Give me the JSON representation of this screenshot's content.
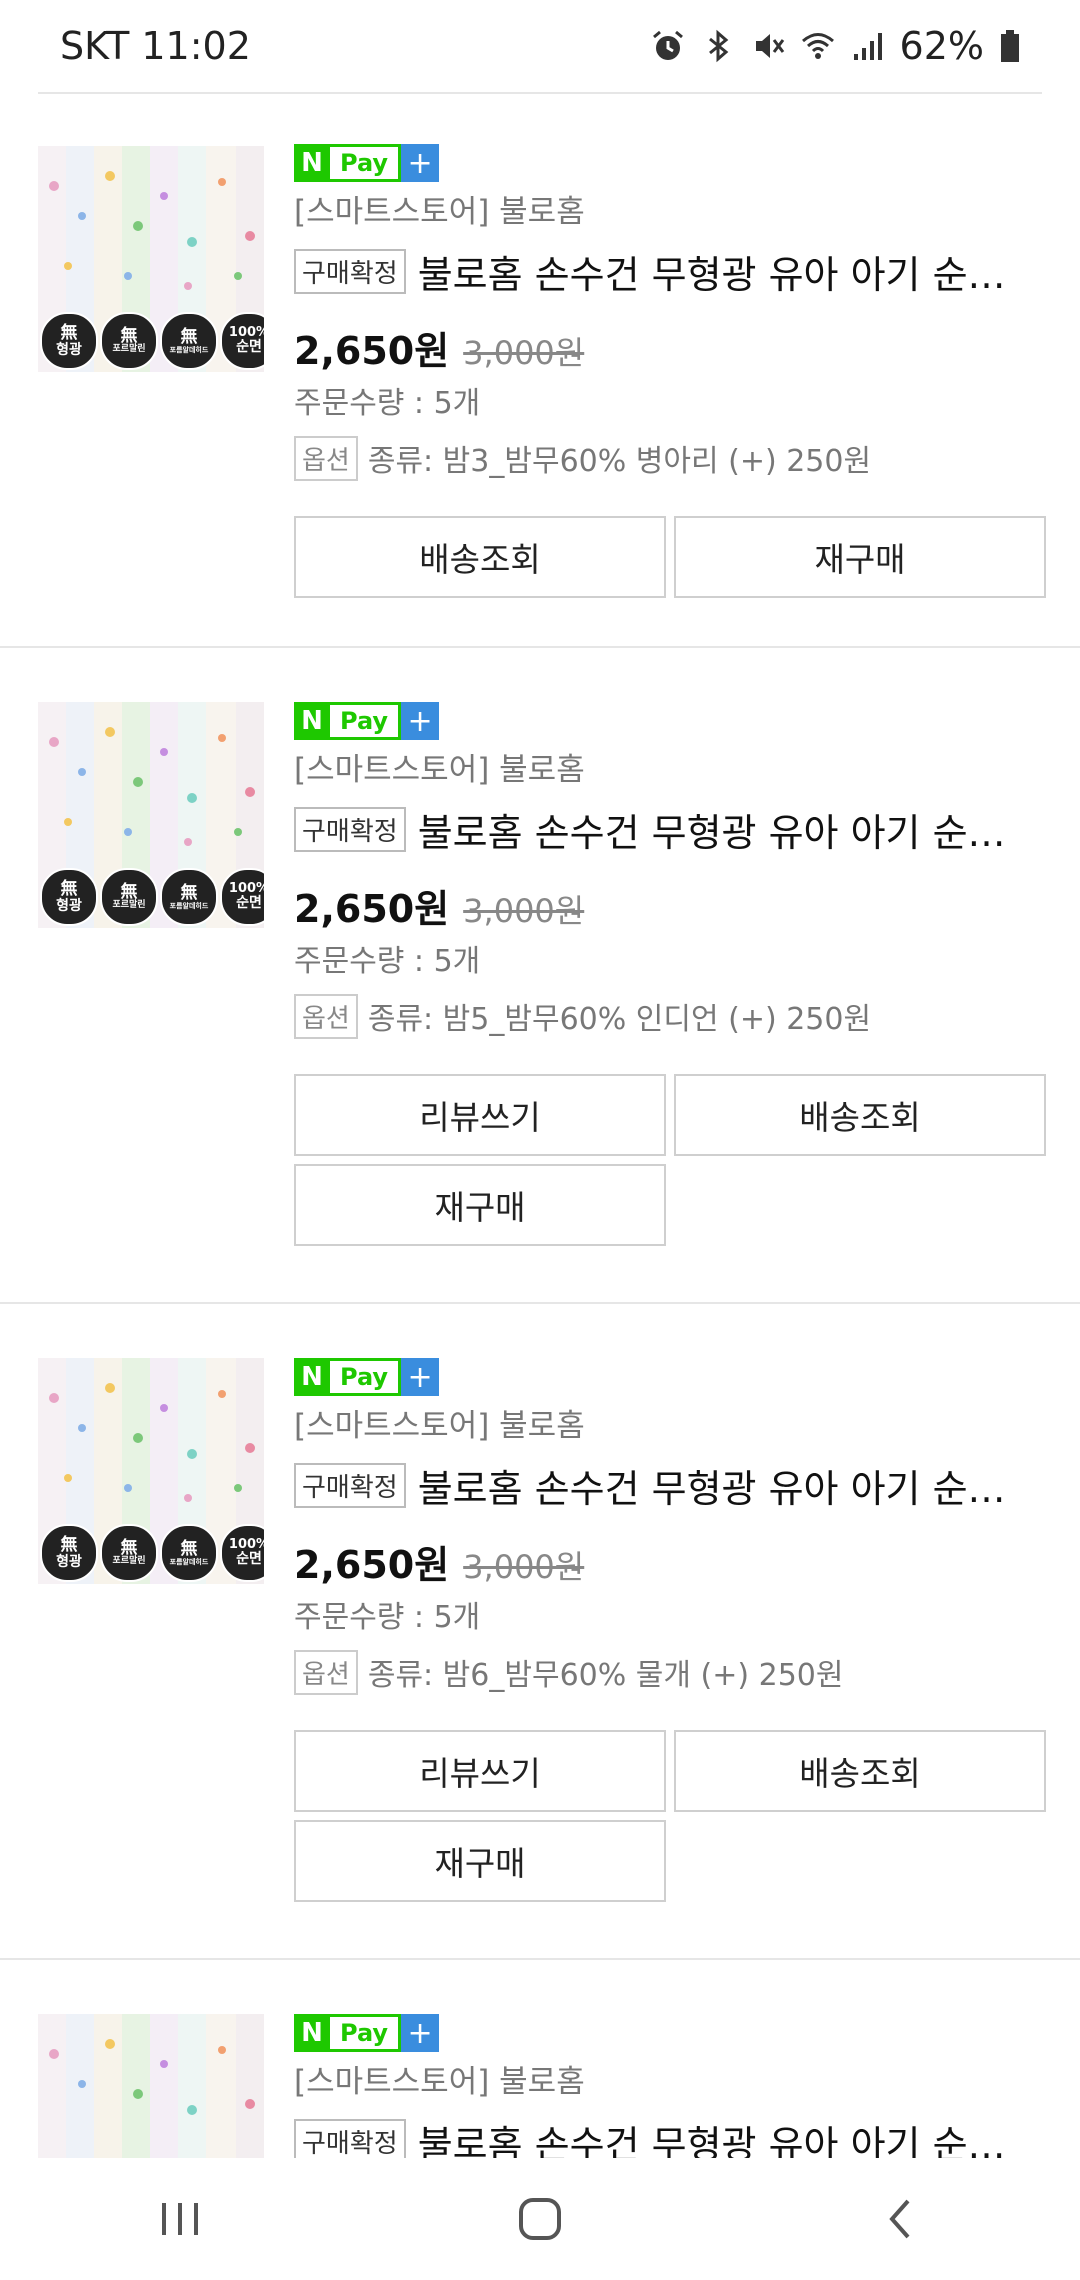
{
  "status_bar": {
    "carrier_time": "SKT 11:02",
    "battery": "62%",
    "icons": [
      "alarm-icon",
      "bluetooth-icon",
      "vibrate-mute-icon",
      "wifi-icon",
      "signal-icon",
      "battery-icon"
    ]
  },
  "colors": {
    "naver_green": "#1ec800",
    "naver_blue": "#3a8dde",
    "border": "#cfcfcf",
    "muted_text": "#777777"
  },
  "orders": [
    {
      "pay_badge": {
        "n": "N",
        "pay": "Pay",
        "plus": "+"
      },
      "store": "[스마트스토어] 불로홈",
      "status_tag": "구매확정",
      "title": "불로홈 손수건 무형광 유아 아기 순…",
      "price": "2,650원",
      "original_price": "3,000원",
      "quantity": "주문수량 : 5개",
      "option_tag": "옵션",
      "option": "종류: 밤3_밤무60% 병아리 (+) 250원",
      "buttons": [
        "배송조회",
        "재구매"
      ]
    },
    {
      "pay_badge": {
        "n": "N",
        "pay": "Pay",
        "plus": "+"
      },
      "store": "[스마트스토어] 불로홈",
      "status_tag": "구매확정",
      "title": "불로홈 손수건 무형광 유아 아기 순…",
      "price": "2,650원",
      "original_price": "3,000원",
      "quantity": "주문수량 : 5개",
      "option_tag": "옵션",
      "option": "종류: 밤5_밤무60% 인디언 (+) 250원",
      "buttons": [
        "리뷰쓰기",
        "배송조회",
        "재구매"
      ]
    },
    {
      "pay_badge": {
        "n": "N",
        "pay": "Pay",
        "plus": "+"
      },
      "store": "[스마트스토어] 불로홈",
      "status_tag": "구매확정",
      "title": "불로홈 손수건 무형광 유아 아기 순…",
      "price": "2,650원",
      "original_price": "3,000원",
      "quantity": "주문수량 : 5개",
      "option_tag": "옵션",
      "option": "종류: 밤6_밤무60% 물개 (+) 250원",
      "buttons": [
        "리뷰쓰기",
        "배송조회",
        "재구매"
      ]
    },
    {
      "pay_badge": {
        "n": "N",
        "pay": "Pay",
        "plus": "+"
      },
      "store": "[스마트스토어] 불로홈",
      "status_tag": "구매확정",
      "title": "불로홈 손수건 무형광 유아 아기 순…"
    }
  ],
  "thumbnail": {
    "badges": [
      {
        "top": "無",
        "bottom": "형광"
      },
      {
        "top": "無",
        "bottom": "포르말린"
      },
      {
        "top": "無",
        "bottom": "포름알데히드"
      },
      {
        "top": "100%",
        "bottom": "순면"
      }
    ]
  },
  "nav_bar": {
    "icons": [
      "recent-apps-icon",
      "home-icon",
      "back-icon"
    ]
  }
}
